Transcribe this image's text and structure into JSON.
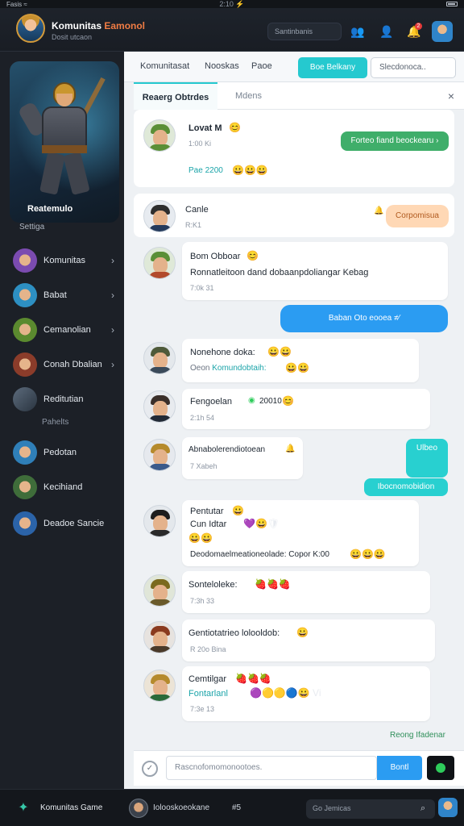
{
  "statusbar": {
    "left": "Fasis ≈",
    "time": "2:10 ⚡"
  },
  "topbar": {
    "title_main": "Komunitas ",
    "title_highlight": "Eamonol",
    "subtitle": "Dosit utcaon",
    "search": "Santinbanis",
    "icons": [
      "people-icon",
      "add-user-icon",
      "notification-icon"
    ],
    "badge": "2"
  },
  "sidebar": {
    "hero_name": "Reatemulo",
    "hero_settings": "Settiga",
    "items": [
      {
        "label": "Komunitas",
        "chevron": "›"
      },
      {
        "label": "Babat",
        "chevron": "›"
      },
      {
        "label": "Cemanolian",
        "chevron": "›"
      },
      {
        "label": "Conah Dbalian",
        "chevron": "›"
      },
      {
        "label": "Reditutian"
      },
      {
        "label": "Pedotan"
      },
      {
        "label": "Kecihiand"
      },
      {
        "label": "Deadoe Sancie"
      }
    ],
    "sub_label": "Pahelts"
  },
  "main": {
    "tabs": [
      "Komunitasat",
      "Nooskas",
      "Paoe"
    ],
    "cyan_button": "Boe Belkany",
    "top_field": "Slecdonoca..",
    "subtabs": {
      "active": "Reaerg Obtrdes",
      "other": "Mdens",
      "close": "×"
    }
  },
  "messages": [
    {
      "name": "Lovat M",
      "emoji": "😊",
      "time": "1:00 Ki",
      "extra": "Pae 2200",
      "extra_emoji": "😀😀😀",
      "bubble": "Forteo fiand beockearu ›"
    },
    {
      "name": "Canle",
      "time": "R:K1",
      "bubble": "Corpomisua",
      "bubble_icon": "🔔"
    },
    {
      "name": "Bom Obboar",
      "emoji": "😊",
      "line": "Ronnatleitoon dand dobaanpdoliangar Kebag",
      "time": "7:0k 31"
    },
    {
      "bubble": "Baban Oto eooea ≠⁄"
    },
    {
      "name": "Nonehone doka:",
      "emoji": "😀😀",
      "line_prefix": "Oeon ",
      "line_teal": "Komundobtaih:",
      "line_emoji": "😀😀",
      "time": ""
    },
    {
      "name": "Fengoelan",
      "emoji_a": "◉",
      "extra": "20010",
      "emoji": "😊",
      "time": "2:1h 54"
    },
    {
      "name": "Abnabolerendiotoean",
      "emoji": "🔔",
      "time": "7 Xabeh",
      "bubble_top": "Ulbeo",
      "bubble_bottom": "Ibocnomobidion"
    },
    {
      "name": "Pentutar",
      "emoji": "😀",
      "line2_prefix": "Cun Idtar",
      "line2_emoji": "💜😀🛡",
      "line3_emoji": "😀😀",
      "line4": "Deodomaelmeationeolade: Copor K:00",
      "line4_emoji": "😀😀😀",
      "time": ""
    },
    {
      "name": "Sonteloleke:",
      "emoji": "🍓🍓🍓",
      "time": "7:3h 33"
    },
    {
      "name": "Gentiotatrieo lolooldob:",
      "emoji": "😀",
      "time": "R 20o Bina"
    },
    {
      "name": "Cemtilgar",
      "emoji": "🍓🍓🍓",
      "line_teal": "Fontarlanl",
      "line_emoji": "🟣🟡🟡🔵😀 Vi",
      "time": "7:3e 13"
    }
  ],
  "footer_note": "Reong Ifadenar",
  "composer": {
    "placeholder": "Rascnofomomonootoes.",
    "send": "Bontl"
  },
  "bottombar": {
    "title": "Komunitas Game",
    "subtitle": "Iolooskoeokane",
    "number": "#5",
    "search": "Go Jemicas"
  }
}
